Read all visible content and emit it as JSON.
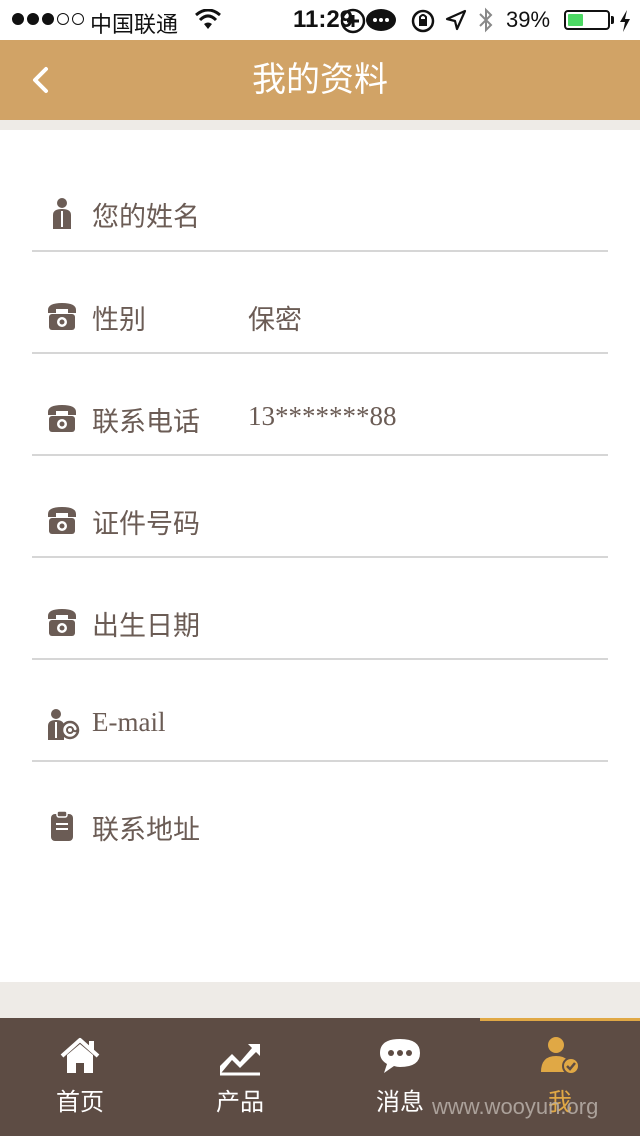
{
  "status_bar": {
    "carrier": "中国联通",
    "time": "11:29",
    "battery": "39%",
    "battery_level": 0.39
  },
  "header": {
    "title": "我的资料",
    "back_icon": "chevron-left-icon"
  },
  "form": {
    "rows": [
      {
        "label": "您的姓名",
        "value": "",
        "icon": "user-icon"
      },
      {
        "label": "性别",
        "value": "保密",
        "icon": "phone-icon"
      },
      {
        "label": "联系电话",
        "value": "13*******88",
        "icon": "phone-icon"
      },
      {
        "label": "证件号码",
        "value": "",
        "icon": "phone-icon"
      },
      {
        "label": "出生日期",
        "value": "",
        "icon": "phone-icon"
      },
      {
        "label": "E-mail",
        "value": "",
        "icon": "user-mail-icon"
      },
      {
        "label": "联系地址",
        "value": "",
        "icon": "clipboard-icon"
      }
    ]
  },
  "tabbar": {
    "tabs": [
      {
        "label": "首页",
        "icon": "home-icon"
      },
      {
        "label": "产品",
        "icon": "trend-chart-icon"
      },
      {
        "label": "消息",
        "icon": "chat-bubble-icon"
      },
      {
        "label": "我",
        "icon": "user-check-icon"
      }
    ],
    "active_index": 3
  },
  "watermark": "www.wooyun.org",
  "colors": {
    "header_bg": "#d1a366",
    "tabbar_bg": "#5d4c44",
    "accent": "#e0a845",
    "text": "#6b5c55"
  }
}
